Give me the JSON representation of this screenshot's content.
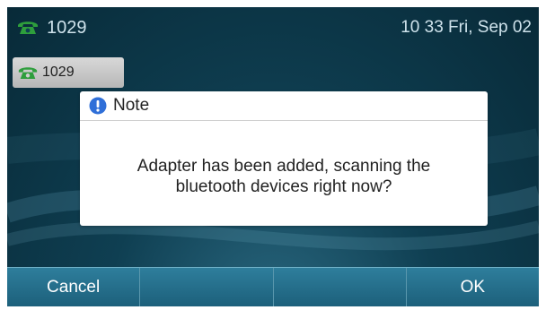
{
  "status_bar": {
    "account": "1029",
    "datetime": "10 33 Fri, Sep 02",
    "icon": "phone-handset-icon"
  },
  "line_key": {
    "label": "1029",
    "icon": "phone-handset-icon"
  },
  "dialog": {
    "title": "Note",
    "icon": "info-icon",
    "message_line1": "Adapter has been added, scanning the",
    "message_line2": "bluetooth devices right now?"
  },
  "softkeys": [
    "Cancel",
    "",
    "",
    "OK"
  ],
  "colors": {
    "accent_green": "#2e9e3c",
    "info_blue": "#2f6fd8",
    "softkey_bar": "#2a7494"
  }
}
